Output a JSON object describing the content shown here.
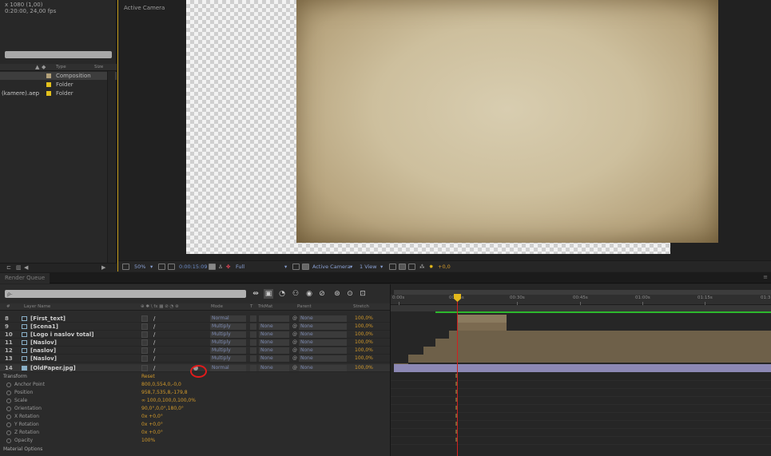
{
  "project": {
    "info_line1": "x 1080 (1,00)",
    "info_line2": "0:20:00, 24,00 fps",
    "header": {
      "type": "Type",
      "size": "Size"
    },
    "items": [
      {
        "name": "",
        "type": "Composition",
        "selected": true
      },
      {
        "name": "",
        "type": "Folder",
        "selected": false
      },
      {
        "name": "(kamere).aep",
        "type": "Folder",
        "selected": false
      }
    ]
  },
  "viewer": {
    "label": "Active Camera",
    "toolbar": {
      "zoom": "50%",
      "timecode": "0:00:15:09",
      "resolution": "Full",
      "camera": "Active Camera",
      "view": "1 View",
      "exposure": "+0,0"
    }
  },
  "tabs": {
    "render_queue": "Render Queue"
  },
  "timeline": {
    "search_placeholder": "ρ-",
    "columns": {
      "num": "#",
      "layer_name": "Layer Name",
      "switches": "⊕ ✱ \\ fx ▦ ⊘ ◔ ⊛",
      "mode": "Mode",
      "t": "T",
      "trkmat": "TrkMat",
      "parent": "Parent",
      "stretch": "Stretch"
    },
    "layers": [
      {
        "num": "8",
        "name": "[First_text]",
        "mode": "Normal",
        "trkmat": "",
        "parent": "None",
        "stretch": "100,0%",
        "type": "comp"
      },
      {
        "num": "9",
        "name": "[Scena1]",
        "mode": "Multiply",
        "trkmat": "None",
        "parent": "None",
        "stretch": "100,0%",
        "type": "comp"
      },
      {
        "num": "10",
        "name": "[Logo i naslov total]",
        "mode": "Multiply",
        "trkmat": "None",
        "parent": "None",
        "stretch": "100,0%",
        "type": "comp"
      },
      {
        "num": "11",
        "name": "[Naslov]",
        "mode": "Multiply",
        "trkmat": "None",
        "parent": "None",
        "stretch": "100,0%",
        "type": "comp"
      },
      {
        "num": "12",
        "name": "[naslov]",
        "mode": "Multiply",
        "trkmat": "None",
        "parent": "None",
        "stretch": "100,0%",
        "type": "comp"
      },
      {
        "num": "13",
        "name": "[Naslov]",
        "mode": "Multiply",
        "trkmat": "None",
        "parent": "None",
        "stretch": "100,0%",
        "type": "comp"
      },
      {
        "num": "14",
        "name": "[OldPaper.jpg]",
        "mode": "Normal",
        "trkmat": "None",
        "parent": "None",
        "stretch": "100,0%",
        "type": "image"
      }
    ],
    "transform": {
      "label": "Transform",
      "reset": "Reset",
      "properties": [
        {
          "name": "Anchor Point",
          "value": "800,0,554,0,-0,0"
        },
        {
          "name": "Position",
          "value": "958,7,535,8,-179,8"
        },
        {
          "name": "Scale",
          "value": "∞ 100,0,100,0,100,0%"
        },
        {
          "name": "Orientation",
          "value": "90,0°,0,0°,180,0°"
        },
        {
          "name": "X Rotation",
          "value": "0x +0,0°"
        },
        {
          "name": "Y Rotation",
          "value": "0x +0,0°"
        },
        {
          "name": "Z Rotation",
          "value": "0x +0,0°"
        },
        {
          "name": "Opacity",
          "value": "100%"
        }
      ],
      "material_options": "Material Options"
    },
    "ruler": {
      "labels": [
        "0:00s",
        "00:15s",
        "00:30s",
        "00:45s",
        "01:00s",
        "01:15s",
        "01:3"
      ]
    }
  },
  "colors": {
    "accent": "#e3b81c",
    "value_orange": "#d39a2b",
    "cti_red": "#d02020",
    "highlight_circle": "#e11b1b",
    "render_green": "#2db82d"
  }
}
